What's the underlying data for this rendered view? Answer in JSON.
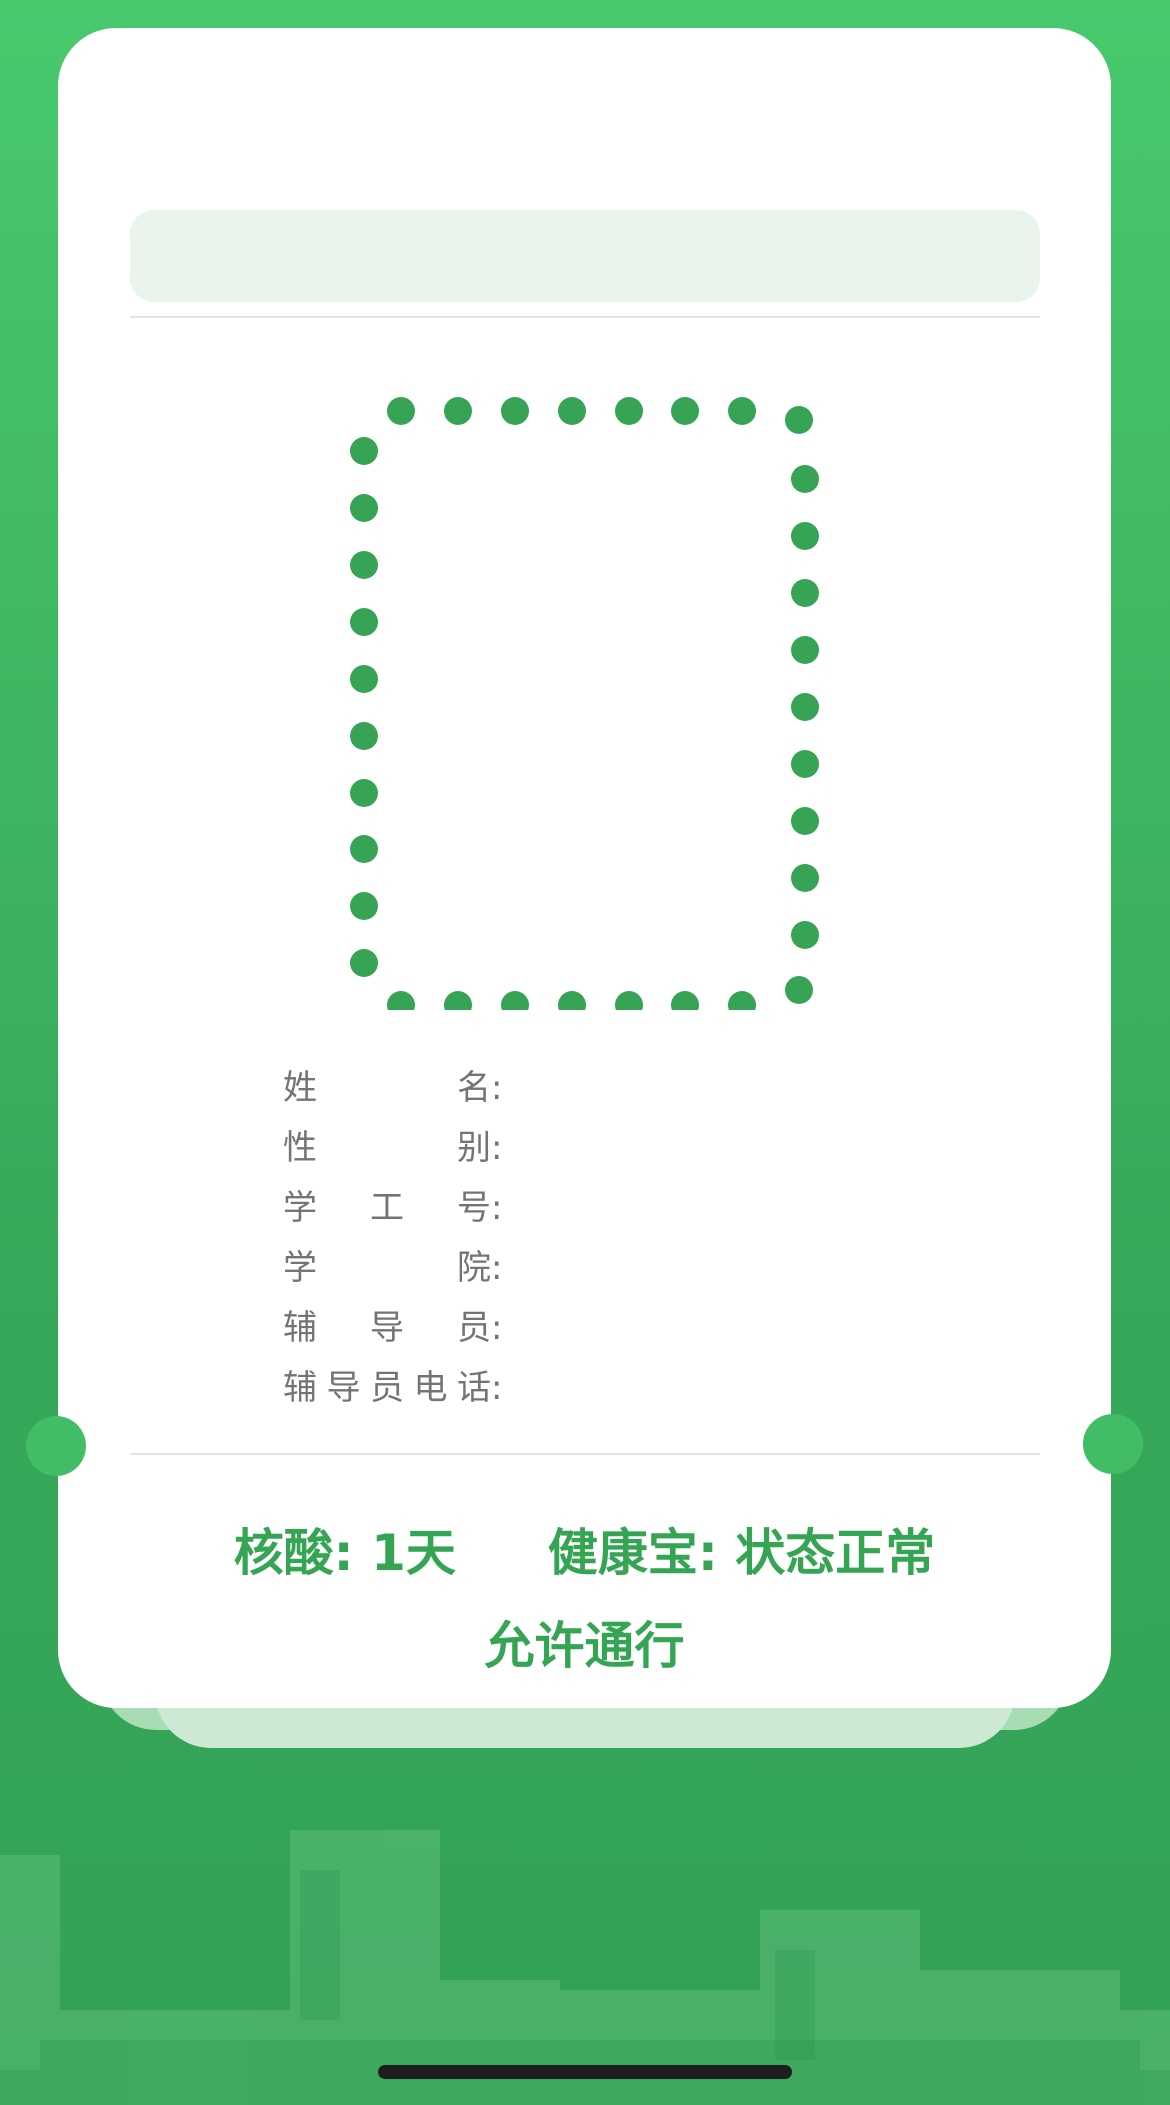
{
  "card": {
    "info_rows": [
      {
        "label": "姓名",
        "value": ""
      },
      {
        "label": "性别",
        "value": ""
      },
      {
        "label": "学工号",
        "value": ""
      },
      {
        "label": "学院",
        "value": ""
      },
      {
        "label": "辅导员",
        "value": ""
      },
      {
        "label": "辅导员电话",
        "value": ""
      }
    ],
    "colon": ":",
    "nucleic_test": "核酸: 1天",
    "health_code": "健康宝: 状态正常",
    "pass_status": "允许通行"
  },
  "colors": {
    "accent": "#35a554",
    "background_top": "#48c96c",
    "background_bottom": "#33a156",
    "photo_dots": "#37a455"
  }
}
